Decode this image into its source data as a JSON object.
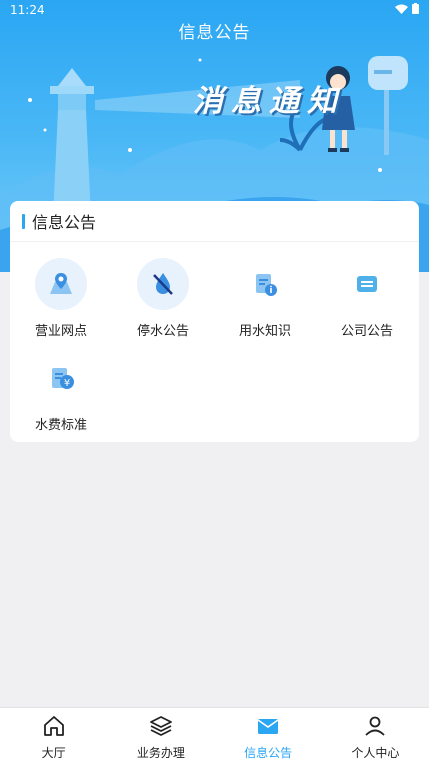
{
  "status_bar": {
    "time": "11:24"
  },
  "header": {
    "title": "信息公告"
  },
  "banner": {
    "text": "消息通知"
  },
  "card": {
    "title": "信息公告",
    "items": [
      {
        "label": "营业网点",
        "icon": "map-pin-icon"
      },
      {
        "label": "停水公告",
        "icon": "no-water-icon"
      },
      {
        "label": "用水知识",
        "icon": "info-doc-icon"
      },
      {
        "label": "公司公告",
        "icon": "notice-icon"
      },
      {
        "label": "水费标准",
        "icon": "fee-doc-icon"
      }
    ]
  },
  "bottom_nav": {
    "items": [
      {
        "label": "大厅",
        "icon": "home-icon"
      },
      {
        "label": "业务办理",
        "icon": "layers-icon"
      },
      {
        "label": "信息公告",
        "icon": "mail-icon"
      },
      {
        "label": "个人中心",
        "icon": "user-icon"
      }
    ],
    "active_index": 2,
    "active_color": "#2aa6f3"
  }
}
